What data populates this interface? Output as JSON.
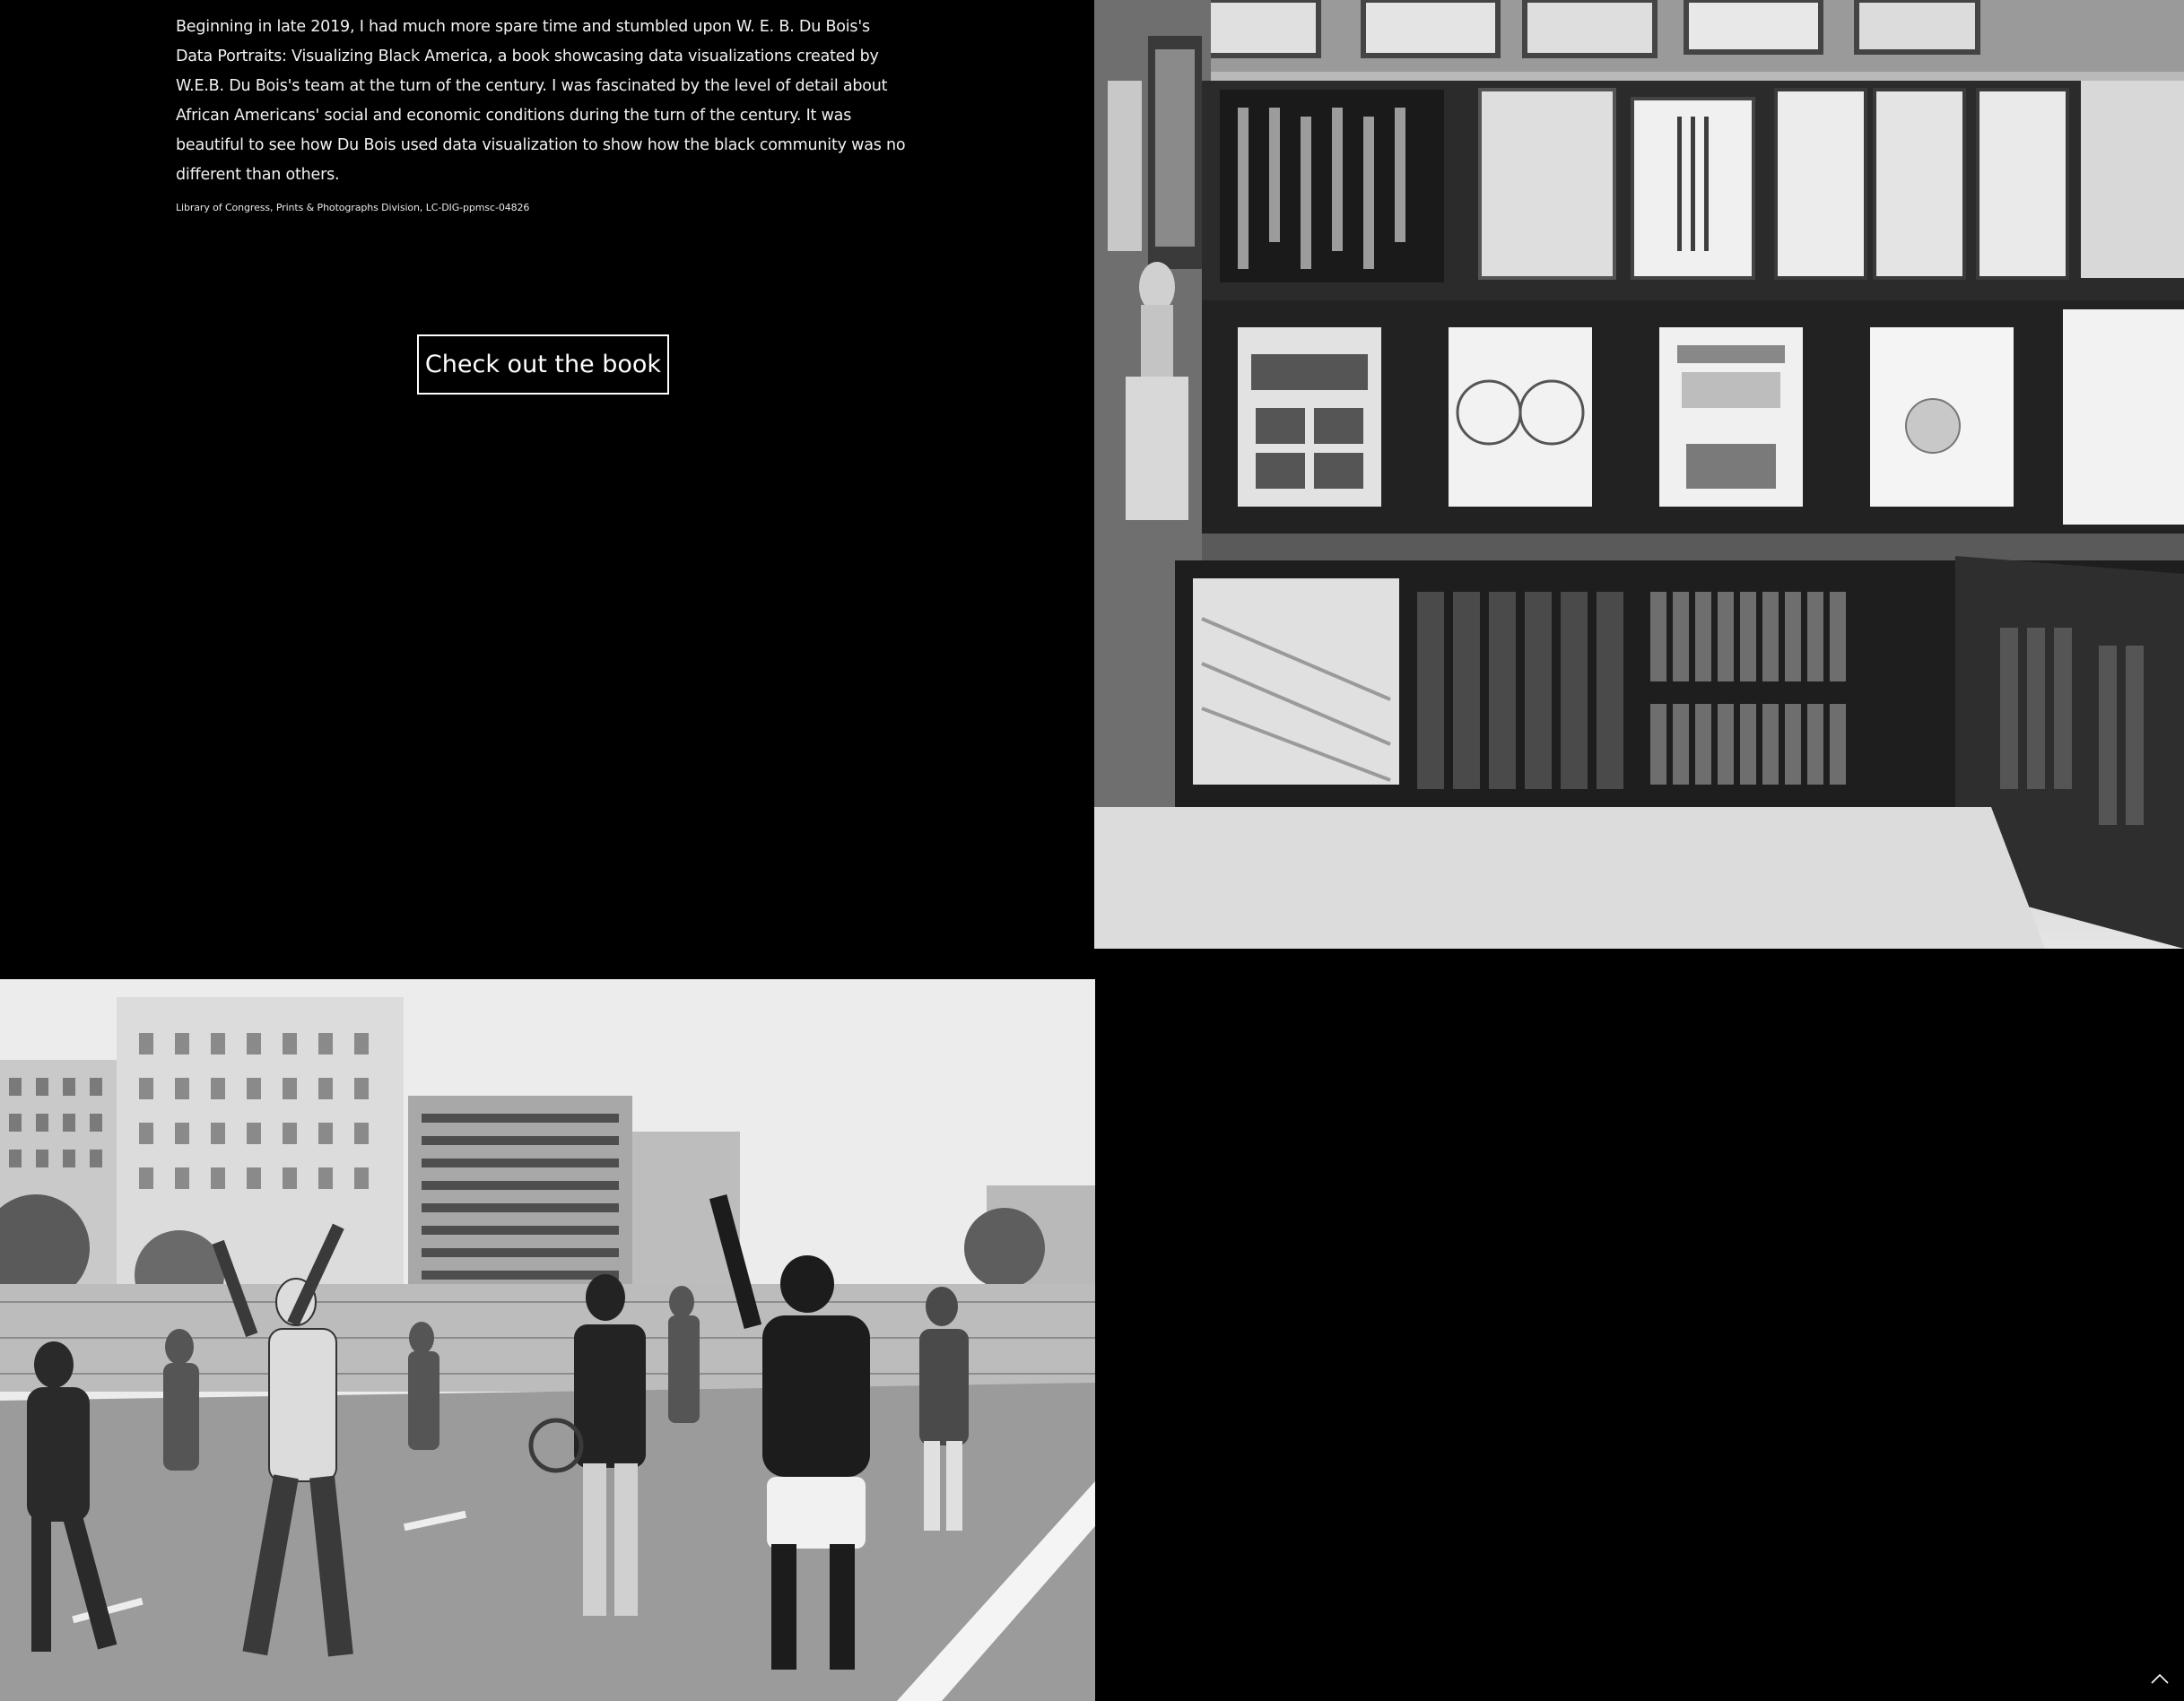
{
  "intro": {
    "paragraph": "Beginning in late 2019, I had much more spare time and stumbled upon W. E. B. Du Bois's Data Portraits: Visualizing Black America, a book showcasing data visualizations created by W.E.B. Du Bois's team at the turn of the century. I was fascinated by the level of detail about African Americans' social and economic conditions during the turn of the century. It was beautiful to see how Du Bois used data visualization to show how the black community was no different than others.",
    "credit": "Library of Congress, Prints & Photographs Division, LC-DIG-ppmsc-04826"
  },
  "cta": {
    "label": "Check out the book"
  },
  "images": {
    "exhibit": "exhibit-photo",
    "protest": "protest-photo"
  },
  "icons": {
    "scroll_top": "chevron-up-icon"
  },
  "colors": {
    "background": "#000000",
    "text": "#ffffff"
  }
}
